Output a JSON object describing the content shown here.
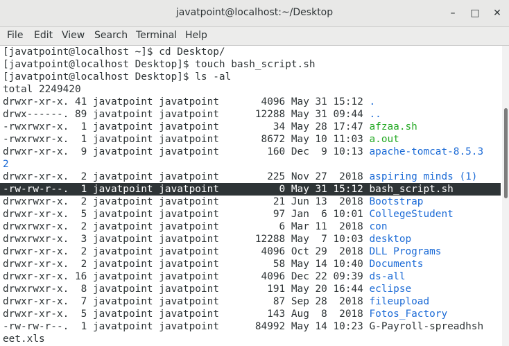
{
  "window": {
    "title": "javatpoint@localhost:~/Desktop",
    "minimize_glyph": "–",
    "maximize_glyph": "□",
    "close_glyph": "✕"
  },
  "menu": [
    "File",
    "Edit",
    "View",
    "Search",
    "Terminal",
    "Help"
  ],
  "terminal": {
    "commands": [
      "[javatpoint@localhost ~]$ cd Desktop/",
      "[javatpoint@localhost Desktop]$ touch bash_script.sh",
      "[javatpoint@localhost Desktop]$ ls -al"
    ],
    "total": "total 2249420",
    "entries": [
      {
        "meta": "drwxr-xr-x. 41 javatpoint javatpoint       4096 May 31 15:12 ",
        "name": ".",
        "kind": "dir",
        "highlight": false
      },
      {
        "meta": "drwx------. 89 javatpoint javatpoint      12288 May 31 09:44 ",
        "name": "..",
        "kind": "dir",
        "highlight": false
      },
      {
        "meta": "-rwxrwxr-x.  1 javatpoint javatpoint         34 May 28 17:47 ",
        "name": "afzaa.sh",
        "kind": "exe",
        "highlight": false
      },
      {
        "meta": "-rwxrwxr-x.  1 javatpoint javatpoint       8672 May 10 11:03 ",
        "name": "a.out",
        "kind": "exe",
        "highlight": false
      },
      {
        "meta": "drwxr-xr-x.  9 javatpoint javatpoint        160 Dec  9 10:13 ",
        "name": "apache-tomcat-8.5.3",
        "kind": "dir",
        "highlight": false
      },
      {
        "meta": "",
        "name": "2",
        "kind": "dir",
        "highlight": false
      },
      {
        "meta": "drwxr-xr-x.  2 javatpoint javatpoint        225 Nov 27  2018 ",
        "name": "aspiring minds (1)",
        "kind": "dir",
        "highlight": false
      },
      {
        "meta": "-rw-rw-r--.  1 javatpoint javatpoint          0 May 31 15:12 ",
        "name": "bash_script.sh",
        "kind": "file",
        "highlight": true
      },
      {
        "meta": "drwxrwxr-x.  2 javatpoint javatpoint         21 Jun 13  2018 ",
        "name": "Bootstrap",
        "kind": "dir",
        "highlight": false
      },
      {
        "meta": "drwxr-xr-x.  5 javatpoint javatpoint         97 Jan  6 10:01 ",
        "name": "CollegeStudent",
        "kind": "dir",
        "highlight": false
      },
      {
        "meta": "drwxrwxr-x.  2 javatpoint javatpoint          6 Mar 11  2018 ",
        "name": "con",
        "kind": "dir",
        "highlight": false
      },
      {
        "meta": "drwxrwxr-x.  3 javatpoint javatpoint      12288 May  7 10:03 ",
        "name": "desktop",
        "kind": "dir",
        "highlight": false
      },
      {
        "meta": "drwxr-xr-x.  2 javatpoint javatpoint       4096 Oct 29  2018 ",
        "name": "DLL Programs",
        "kind": "dir",
        "highlight": false
      },
      {
        "meta": "drwxr-xr-x.  2 javatpoint javatpoint         58 May 14 10:40 ",
        "name": "Documents",
        "kind": "dir",
        "highlight": false
      },
      {
        "meta": "drwxr-xr-x. 16 javatpoint javatpoint       4096 Dec 22 09:39 ",
        "name": "ds-all",
        "kind": "dir",
        "highlight": false
      },
      {
        "meta": "drwxrwxr-x.  8 javatpoint javatpoint        191 May 20 16:44 ",
        "name": "eclipse",
        "kind": "dir",
        "highlight": false
      },
      {
        "meta": "drwxr-xr-x.  7 javatpoint javatpoint         87 Sep 28  2018 ",
        "name": "fileupload",
        "kind": "dir",
        "highlight": false
      },
      {
        "meta": "drwxr-xr-x.  5 javatpoint javatpoint        143 Aug  8  2018 ",
        "name": "Fotos_Factory",
        "kind": "dir",
        "highlight": false
      },
      {
        "meta": "-rw-rw-r--.  1 javatpoint javatpoint      84992 May 14 10:23 ",
        "name": "G-Payroll-spreadhsh",
        "kind": "file",
        "highlight": false
      },
      {
        "meta": "",
        "name": "eet.xls",
        "kind": "file",
        "highlight": false
      }
    ]
  },
  "colors": {
    "directory": "#1c6bd6",
    "executable": "#24a924",
    "text": "#2e3436",
    "highlight_bg": "#2e3436",
    "highlight_fg": "#ffffff"
  }
}
